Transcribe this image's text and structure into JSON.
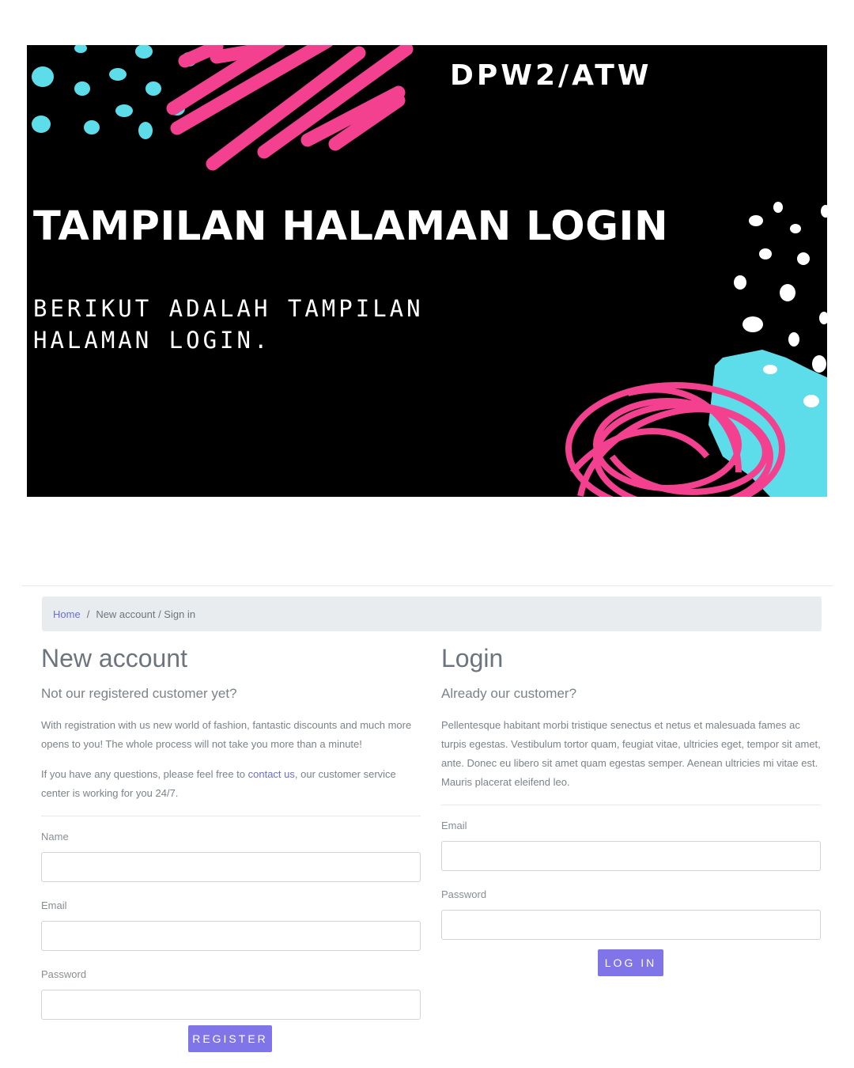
{
  "banner": {
    "tag": "DPW2/ATW",
    "title": "TAMPILAN HALAMAN LOGIN",
    "subtitle_line1": "BERIKUT ADALAH TAMPILAN",
    "subtitle_line2": "HALAMAN LOGIN."
  },
  "breadcrumb": {
    "home": "Home",
    "separator": "/",
    "current": "New account / Sign in"
  },
  "new_account": {
    "title": "New account",
    "lead": "Not our registered customer yet?",
    "para1": "With registration with us new world of fashion, fantastic discounts and much more opens to you! The whole process will not take you more than a minute!",
    "para2_before": "If you have any questions, please feel free to ",
    "para2_link": "contact us",
    "para2_after": ", our customer service center is working for you 24/7.",
    "name_label": "Name",
    "email_label": "Email",
    "password_label": "Password",
    "register_button": "REGISTER"
  },
  "login": {
    "title": "Login",
    "lead": "Already our customer?",
    "para": "Pellentesque habitant morbi tristique senectus et netus et malesuada fames ac turpis egestas. Vestibulum tortor quam, feugiat vitae, ultricies eget, tempor sit amet, ante. Donec eu libero sit amet quam egestas semper. Aenean ultricies mi vitae est. Mauris placerat eleifend leo.",
    "email_label": "Email",
    "password_label": "Password",
    "login_button": "LOG IN"
  },
  "colors": {
    "banner_bg": "#000000",
    "accent_pink": "#f3418f",
    "accent_cyan": "#5ddde9",
    "button": "#7f75e8",
    "link": "#6b6fcf"
  }
}
